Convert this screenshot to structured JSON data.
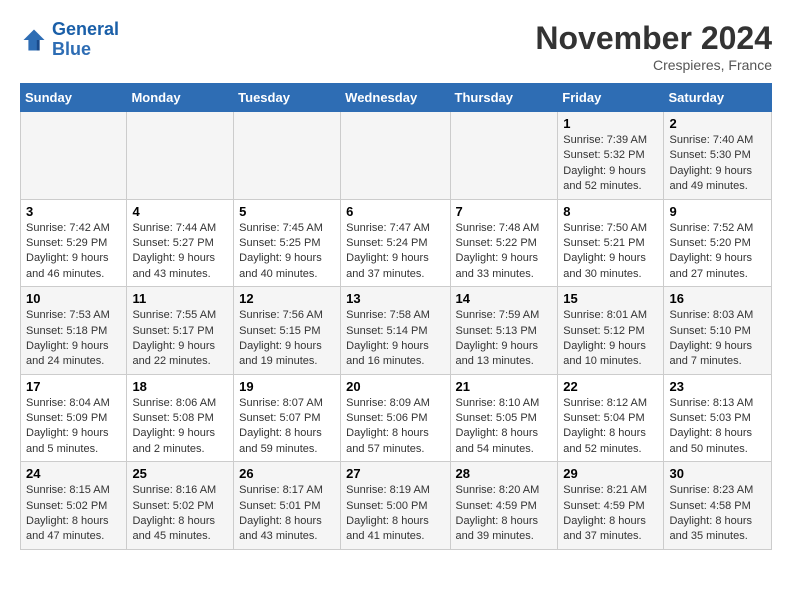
{
  "logo": {
    "line1": "General",
    "line2": "Blue"
  },
  "title": "November 2024",
  "location": "Crespieres, France",
  "weekdays": [
    "Sunday",
    "Monday",
    "Tuesday",
    "Wednesday",
    "Thursday",
    "Friday",
    "Saturday"
  ],
  "weeks": [
    [
      {
        "day": "",
        "sunrise": "",
        "sunset": "",
        "daylight": ""
      },
      {
        "day": "",
        "sunrise": "",
        "sunset": "",
        "daylight": ""
      },
      {
        "day": "",
        "sunrise": "",
        "sunset": "",
        "daylight": ""
      },
      {
        "day": "",
        "sunrise": "",
        "sunset": "",
        "daylight": ""
      },
      {
        "day": "",
        "sunrise": "",
        "sunset": "",
        "daylight": ""
      },
      {
        "day": "1",
        "sunrise": "Sunrise: 7:39 AM",
        "sunset": "Sunset: 5:32 PM",
        "daylight": "Daylight: 9 hours and 52 minutes."
      },
      {
        "day": "2",
        "sunrise": "Sunrise: 7:40 AM",
        "sunset": "Sunset: 5:30 PM",
        "daylight": "Daylight: 9 hours and 49 minutes."
      }
    ],
    [
      {
        "day": "3",
        "sunrise": "Sunrise: 7:42 AM",
        "sunset": "Sunset: 5:29 PM",
        "daylight": "Daylight: 9 hours and 46 minutes."
      },
      {
        "day": "4",
        "sunrise": "Sunrise: 7:44 AM",
        "sunset": "Sunset: 5:27 PM",
        "daylight": "Daylight: 9 hours and 43 minutes."
      },
      {
        "day": "5",
        "sunrise": "Sunrise: 7:45 AM",
        "sunset": "Sunset: 5:25 PM",
        "daylight": "Daylight: 9 hours and 40 minutes."
      },
      {
        "day": "6",
        "sunrise": "Sunrise: 7:47 AM",
        "sunset": "Sunset: 5:24 PM",
        "daylight": "Daylight: 9 hours and 37 minutes."
      },
      {
        "day": "7",
        "sunrise": "Sunrise: 7:48 AM",
        "sunset": "Sunset: 5:22 PM",
        "daylight": "Daylight: 9 hours and 33 minutes."
      },
      {
        "day": "8",
        "sunrise": "Sunrise: 7:50 AM",
        "sunset": "Sunset: 5:21 PM",
        "daylight": "Daylight: 9 hours and 30 minutes."
      },
      {
        "day": "9",
        "sunrise": "Sunrise: 7:52 AM",
        "sunset": "Sunset: 5:20 PM",
        "daylight": "Daylight: 9 hours and 27 minutes."
      }
    ],
    [
      {
        "day": "10",
        "sunrise": "Sunrise: 7:53 AM",
        "sunset": "Sunset: 5:18 PM",
        "daylight": "Daylight: 9 hours and 24 minutes."
      },
      {
        "day": "11",
        "sunrise": "Sunrise: 7:55 AM",
        "sunset": "Sunset: 5:17 PM",
        "daylight": "Daylight: 9 hours and 22 minutes."
      },
      {
        "day": "12",
        "sunrise": "Sunrise: 7:56 AM",
        "sunset": "Sunset: 5:15 PM",
        "daylight": "Daylight: 9 hours and 19 minutes."
      },
      {
        "day": "13",
        "sunrise": "Sunrise: 7:58 AM",
        "sunset": "Sunset: 5:14 PM",
        "daylight": "Daylight: 9 hours and 16 minutes."
      },
      {
        "day": "14",
        "sunrise": "Sunrise: 7:59 AM",
        "sunset": "Sunset: 5:13 PM",
        "daylight": "Daylight: 9 hours and 13 minutes."
      },
      {
        "day": "15",
        "sunrise": "Sunrise: 8:01 AM",
        "sunset": "Sunset: 5:12 PM",
        "daylight": "Daylight: 9 hours and 10 minutes."
      },
      {
        "day": "16",
        "sunrise": "Sunrise: 8:03 AM",
        "sunset": "Sunset: 5:10 PM",
        "daylight": "Daylight: 9 hours and 7 minutes."
      }
    ],
    [
      {
        "day": "17",
        "sunrise": "Sunrise: 8:04 AM",
        "sunset": "Sunset: 5:09 PM",
        "daylight": "Daylight: 9 hours and 5 minutes."
      },
      {
        "day": "18",
        "sunrise": "Sunrise: 8:06 AM",
        "sunset": "Sunset: 5:08 PM",
        "daylight": "Daylight: 9 hours and 2 minutes."
      },
      {
        "day": "19",
        "sunrise": "Sunrise: 8:07 AM",
        "sunset": "Sunset: 5:07 PM",
        "daylight": "Daylight: 8 hours and 59 minutes."
      },
      {
        "day": "20",
        "sunrise": "Sunrise: 8:09 AM",
        "sunset": "Sunset: 5:06 PM",
        "daylight": "Daylight: 8 hours and 57 minutes."
      },
      {
        "day": "21",
        "sunrise": "Sunrise: 8:10 AM",
        "sunset": "Sunset: 5:05 PM",
        "daylight": "Daylight: 8 hours and 54 minutes."
      },
      {
        "day": "22",
        "sunrise": "Sunrise: 8:12 AM",
        "sunset": "Sunset: 5:04 PM",
        "daylight": "Daylight: 8 hours and 52 minutes."
      },
      {
        "day": "23",
        "sunrise": "Sunrise: 8:13 AM",
        "sunset": "Sunset: 5:03 PM",
        "daylight": "Daylight: 8 hours and 50 minutes."
      }
    ],
    [
      {
        "day": "24",
        "sunrise": "Sunrise: 8:15 AM",
        "sunset": "Sunset: 5:02 PM",
        "daylight": "Daylight: 8 hours and 47 minutes."
      },
      {
        "day": "25",
        "sunrise": "Sunrise: 8:16 AM",
        "sunset": "Sunset: 5:02 PM",
        "daylight": "Daylight: 8 hours and 45 minutes."
      },
      {
        "day": "26",
        "sunrise": "Sunrise: 8:17 AM",
        "sunset": "Sunset: 5:01 PM",
        "daylight": "Daylight: 8 hours and 43 minutes."
      },
      {
        "day": "27",
        "sunrise": "Sunrise: 8:19 AM",
        "sunset": "Sunset: 5:00 PM",
        "daylight": "Daylight: 8 hours and 41 minutes."
      },
      {
        "day": "28",
        "sunrise": "Sunrise: 8:20 AM",
        "sunset": "Sunset: 4:59 PM",
        "daylight": "Daylight: 8 hours and 39 minutes."
      },
      {
        "day": "29",
        "sunrise": "Sunrise: 8:21 AM",
        "sunset": "Sunset: 4:59 PM",
        "daylight": "Daylight: 8 hours and 37 minutes."
      },
      {
        "day": "30",
        "sunrise": "Sunrise: 8:23 AM",
        "sunset": "Sunset: 4:58 PM",
        "daylight": "Daylight: 8 hours and 35 minutes."
      }
    ]
  ]
}
